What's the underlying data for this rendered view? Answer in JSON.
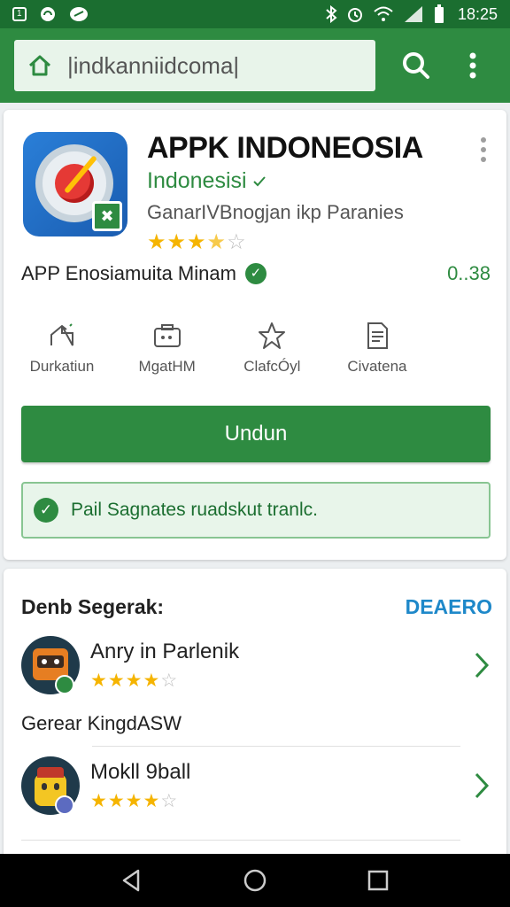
{
  "status_bar": {
    "badge": "1",
    "time": "18:25",
    "icons": [
      "sim-icon",
      "headset-icon",
      "notification-icon",
      "bluetooth-icon",
      "alarm-icon",
      "wifi-icon",
      "signal-icon",
      "battery-icon"
    ]
  },
  "toolbar": {
    "search_query": "|indkanniidcoma|"
  },
  "app": {
    "title": "APPK INDONEOSIA",
    "developer": "Indonesisi",
    "category": "GanarIVBnogjan ikp Paranies",
    "rating": 3.5,
    "rating_max": 5,
    "meta": "APP Enosiamuita Minam",
    "size": "0..38",
    "actions": [
      {
        "label": "Durkatiun",
        "icon": "share-icon"
      },
      {
        "label": "MgatHM",
        "icon": "camera-icon"
      },
      {
        "label": "ClafcÓyl",
        "icon": "star-icon"
      },
      {
        "label": "Civatena",
        "icon": "document-icon"
      }
    ],
    "install_label": "Undun",
    "notice": "Pail Sagnates ruadskut tranlc."
  },
  "recommend": {
    "title": "Denb Segerak:",
    "more": "DEAERO",
    "items": [
      {
        "name": "Anry in Parlenik",
        "rating": 4,
        "badge_color": "#2e8b41"
      },
      {
        "name": "Mokll 9ball",
        "rating": 4,
        "badge_color": "#5c6bc0"
      }
    ],
    "subheading": "Gerear KingdASW"
  },
  "colors": {
    "primary": "#2e8b41",
    "status_bar": "#1b6e30",
    "accent_link": "#1e88c9",
    "star": "#f5b400"
  }
}
